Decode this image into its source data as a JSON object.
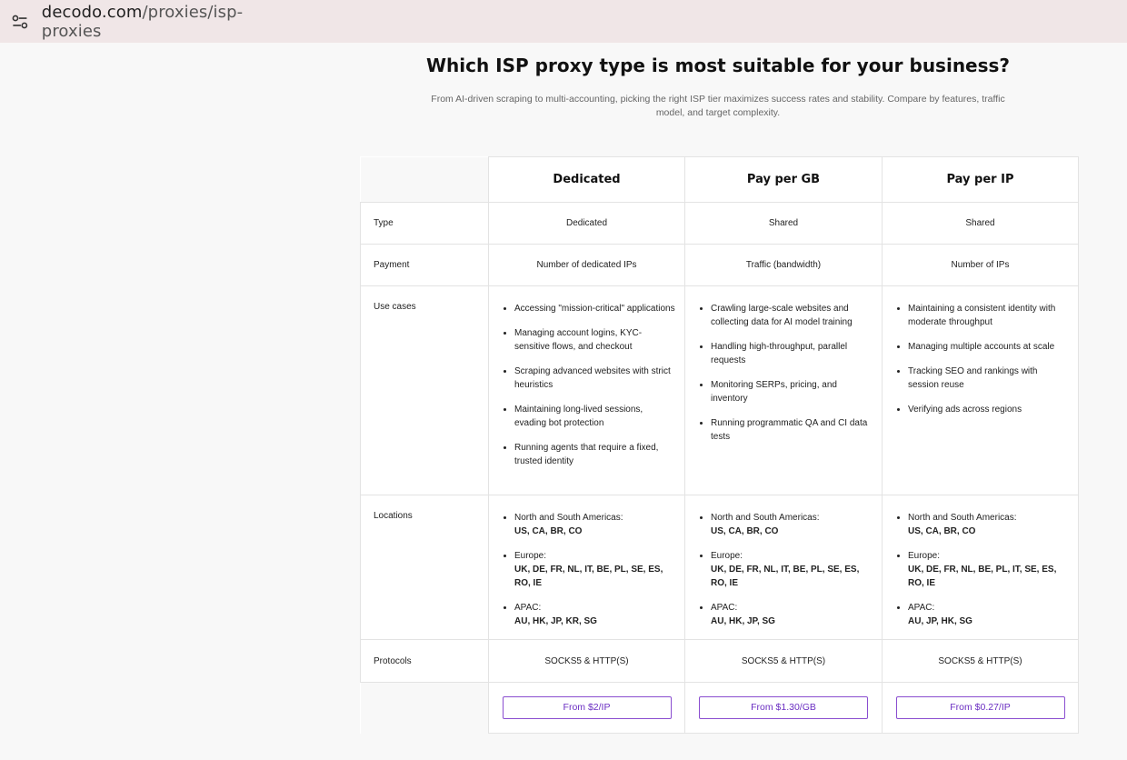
{
  "browser": {
    "url_domain": "decodo.com",
    "url_path": "/proxies/isp-proxies",
    "site_settings_icon": "tune-icon"
  },
  "page": {
    "title": "Which ISP proxy type is most suitable for your business?",
    "subtitle": "From AI-driven scraping to multi-accounting, picking the right ISP tier maximizes success rates and stability. Compare by features, traffic model, and target complexity."
  },
  "table": {
    "columns": [
      "Dedicated",
      "Pay per GB",
      "Pay per IP"
    ],
    "rows": {
      "type": {
        "label": "Type",
        "values": [
          "Dedicated",
          "Shared",
          "Shared"
        ]
      },
      "payment": {
        "label": "Payment",
        "values": [
          "Number of dedicated IPs",
          "Traffic (bandwidth)",
          "Number of IPs"
        ]
      },
      "use_cases": {
        "label": "Use cases",
        "values": [
          [
            "Accessing \"mission-critical\" applications",
            "Managing account logins, KYC-sensitive flows, and checkout",
            "Scraping advanced websites with strict heuristics",
            "Maintaining long-lived sessions, evading bot protection",
            "Running agents that require a fixed, trusted identity"
          ],
          [
            "Crawling large-scale websites and collecting data for AI model training",
            "Handling high-throughput, parallel requests",
            "Monitoring SERPs, pricing, and inventory",
            "Running programmatic QA and CI data tests"
          ],
          [
            "Maintaining a consistent identity with moderate throughput",
            "Managing multiple accounts at scale",
            "Tracking SEO and rankings with session reuse",
            "Verifying ads across regions"
          ]
        ]
      },
      "locations": {
        "label": "Locations",
        "values": [
          [
            {
              "region": "North and South Americas:",
              "codes": "US, CA, BR, CO"
            },
            {
              "region": "Europe:",
              "codes": "UK, DE, FR, NL, IT, BE, PL, SE, ES, RO, IE"
            },
            {
              "region": "APAC:",
              "codes": "AU, HK, JP, KR, SG"
            }
          ],
          [
            {
              "region": "North and South Americas:",
              "codes": "US, CA, BR, CO"
            },
            {
              "region": "Europe:",
              "codes": "UK, DE, FR, NL, IT, BE, PL, SE, ES, RO, IE"
            },
            {
              "region": "APAC:",
              "codes": "AU, HK, JP, SG"
            }
          ],
          [
            {
              "region": "North and South Americas:",
              "codes": "US, CA, BR, CO"
            },
            {
              "region": "Europe:",
              "codes": "UK, DE, FR, NL, BE, PL, IT, SE, ES, RO, IE"
            },
            {
              "region": "APAC:",
              "codes": "AU, JP, HK, SG"
            }
          ]
        ]
      },
      "protocols": {
        "label": "Protocols",
        "values": [
          "SOCKS5 & HTTP(S)",
          "SOCKS5 & HTTP(S)",
          "SOCKS5 & HTTP(S)"
        ]
      }
    },
    "cta": [
      "From $2/IP",
      "From $1.30/GB",
      "From $0.27/IP"
    ]
  },
  "colors": {
    "accent": "#6b2fc2",
    "urlbar_bg": "#f0e6e7"
  }
}
